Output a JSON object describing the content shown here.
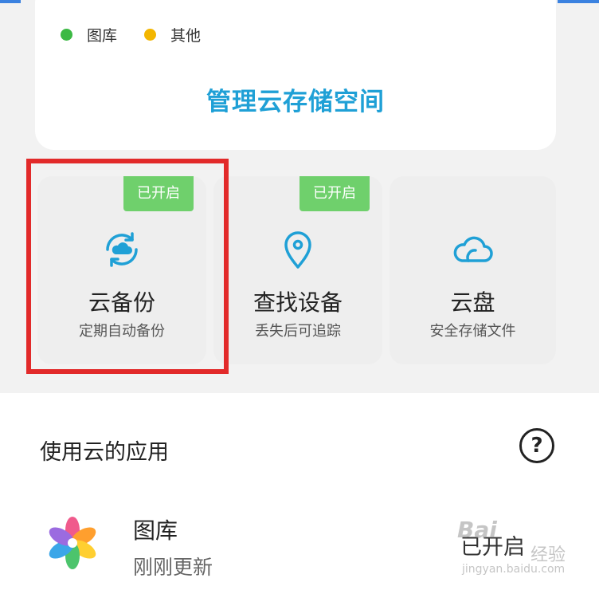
{
  "storage": {
    "legend": [
      {
        "label": "图库",
        "color": "#3cb944"
      },
      {
        "label": "其他",
        "color": "#f3b600"
      }
    ],
    "manage_label": "管理云存储空间"
  },
  "tiles": [
    {
      "badge": "已开启",
      "title": "云备份",
      "subtitle": "定期自动备份",
      "icon": "cloud-sync-icon",
      "highlighted": true
    },
    {
      "badge": "已开启",
      "title": "查找设备",
      "subtitle": "丢失后可追踪",
      "icon": "location-pin-icon"
    },
    {
      "badge": "",
      "title": "云盘",
      "subtitle": "安全存储文件",
      "icon": "cloud-icon"
    }
  ],
  "apps_section": {
    "title": "使用云的应用",
    "help_icon": "question-circle-icon",
    "help_glyph": "?",
    "items": [
      {
        "name": "图库",
        "subtitle": "刚刚更新",
        "status": "已开启",
        "icon": "gallery-flower-icon"
      }
    ]
  },
  "watermark": {
    "logo": "Bai",
    "text": "经验",
    "url": "jingyan.baidu.com"
  },
  "colors": {
    "accent": "#1fa0d6",
    "badge": "#6fd06c",
    "highlight": "#e22a2a"
  }
}
